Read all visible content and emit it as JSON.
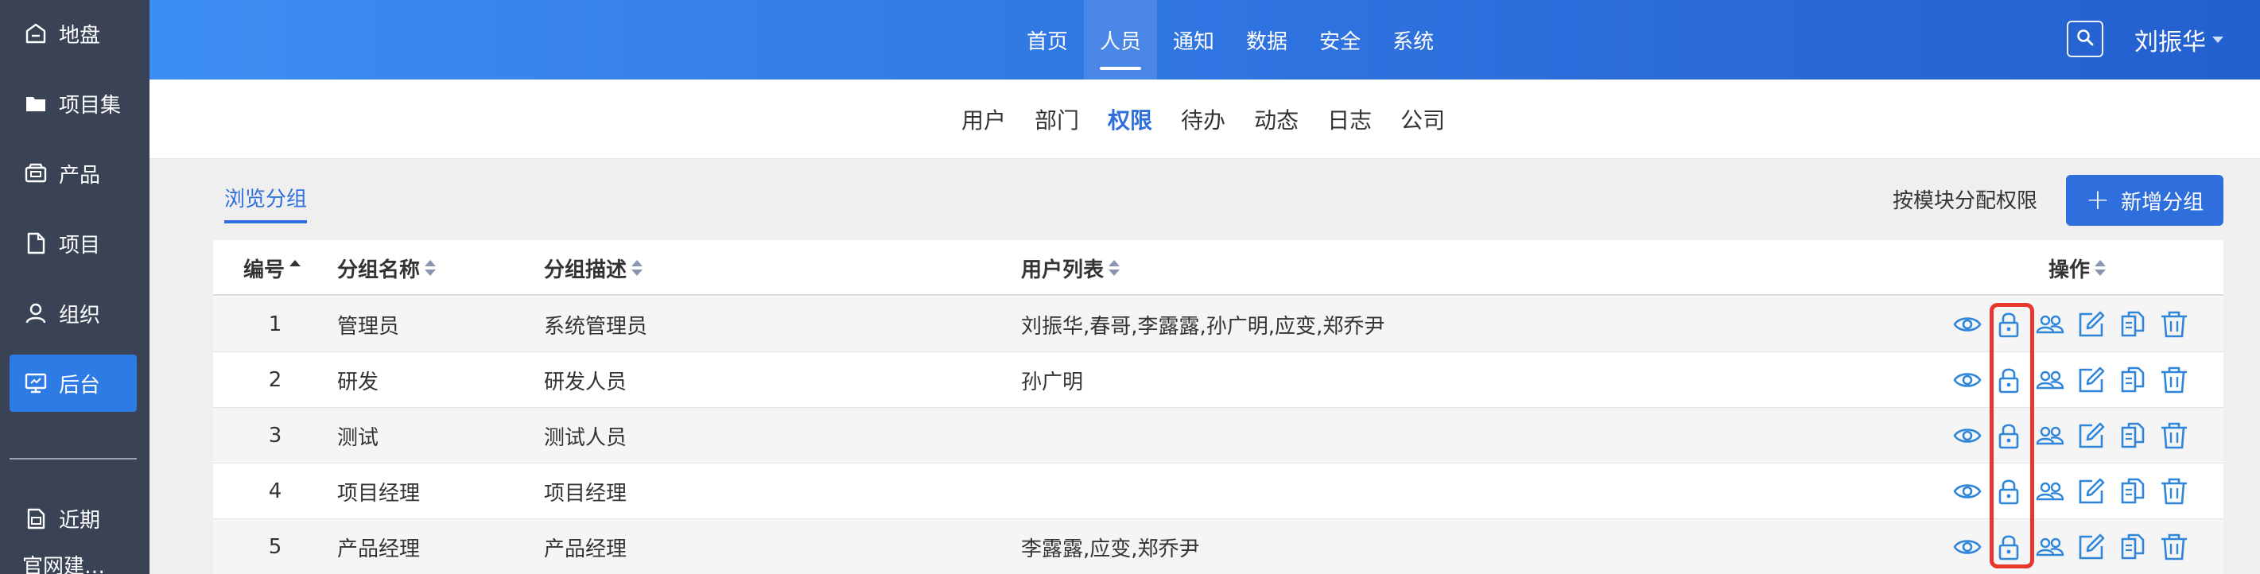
{
  "sidebar": {
    "items": [
      {
        "label": "地盘",
        "icon": "home-icon"
      },
      {
        "label": "项目集",
        "icon": "folder-icon"
      },
      {
        "label": "产品",
        "icon": "product-icon"
      },
      {
        "label": "项目",
        "icon": "file-icon"
      },
      {
        "label": "组织",
        "icon": "user-icon"
      },
      {
        "label": "后台",
        "icon": "monitor-icon"
      },
      {
        "label": "近期",
        "icon": "recent-icon"
      }
    ],
    "recent_sub": "官网建…"
  },
  "header": {
    "nav": [
      "首页",
      "人员",
      "通知",
      "数据",
      "安全",
      "系统"
    ],
    "active_nav": "人员",
    "user_name": "刘振华"
  },
  "subnav": {
    "items": [
      "用户",
      "部门",
      "权限",
      "待办",
      "动态",
      "日志",
      "公司"
    ],
    "active": "权限"
  },
  "toolbar": {
    "browse_tab": "浏览分组",
    "assign_link": "按模块分配权限",
    "add_button": "新增分组"
  },
  "table": {
    "headers": {
      "id": "编号",
      "name": "分组名称",
      "desc": "分组描述",
      "users": "用户列表",
      "actions": "操作"
    },
    "rows": [
      {
        "id": "1",
        "name": "管理员",
        "desc": "系统管理员",
        "users": "刘振华,春哥,李露露,孙广明,应变,郑乔尹"
      },
      {
        "id": "2",
        "name": "研发",
        "desc": "研发人员",
        "users": "孙广明"
      },
      {
        "id": "3",
        "name": "测试",
        "desc": "测试人员",
        "users": ""
      },
      {
        "id": "4",
        "name": "项目经理",
        "desc": "项目经理",
        "users": ""
      },
      {
        "id": "5",
        "name": "产品经理",
        "desc": "产品经理",
        "users": "李露露,应变,郑乔尹"
      }
    ],
    "action_icons": [
      "eye-icon",
      "lock-icon",
      "team-icon",
      "edit-icon",
      "copy-icon",
      "trash-icon"
    ]
  },
  "colors": {
    "accent": "#2f6fdd",
    "sidebar_bg": "#3a4356",
    "action_icon": "#2f86d9",
    "highlight": "#e8372c"
  }
}
